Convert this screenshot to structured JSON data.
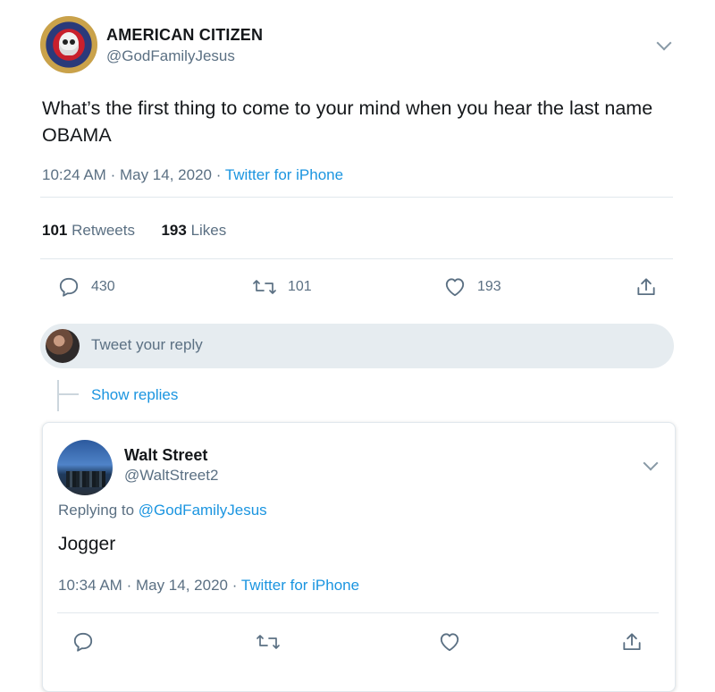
{
  "main_tweet": {
    "display_name": "AMERICAN CITIZEN",
    "handle": "@GodFamilyJesus",
    "text": "What’s the first thing to come to your mind when you hear the last name OBAMA",
    "time": "10:24 AM",
    "date": "May 14, 2020",
    "separator": "·",
    "source": "Twitter for iPhone",
    "retweets_count": "101",
    "retweets_label": "Retweets",
    "likes_count": "193",
    "likes_label": "Likes",
    "actions": {
      "reply_count": "430",
      "retweet_count": "101",
      "like_count": "193"
    }
  },
  "reply_box": {
    "placeholder": "Tweet your reply"
  },
  "thread": {
    "show_replies": "Show replies"
  },
  "reply_tweet": {
    "display_name": "Walt Street",
    "handle": "@WaltStreet2",
    "replying_prefix": "Replying to",
    "replying_to": "@GodFamilyJesus",
    "text": "Jogger",
    "time": "10:34 AM",
    "date": "May 14, 2020",
    "separator": "·",
    "source": "Twitter for iPhone"
  },
  "icons": {
    "reply": "speech-bubble-icon",
    "retweet": "retweet-arrows-icon",
    "like": "heart-icon",
    "share": "share-upload-icon",
    "more": "chevron-down-icon"
  },
  "colors": {
    "accent": "#1b95e0",
    "secondary_text": "#5b7083",
    "reply_box_bg": "#e6ecf0",
    "divider": "#e1e8ed"
  }
}
